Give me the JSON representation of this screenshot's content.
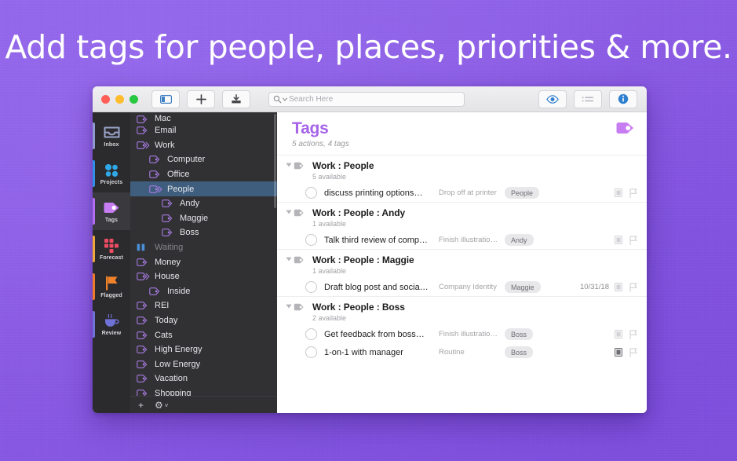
{
  "headline": "Add tags for people, places, priorities & more.",
  "theme": {
    "background_purple": "#8a5ae4",
    "tag_purple": "#a563e8",
    "title_purple": "#a563e8",
    "sidebar_dark": "#313134",
    "rail_dark": "#2b2b2e",
    "selection_blue": "#3f5e7e"
  },
  "titlebar": {
    "traffic_lights": [
      "close-button",
      "minimize-button",
      "zoom-button"
    ],
    "buttons": [
      {
        "name": "sidebar-toggle-button",
        "icon": "sidebar-icon"
      },
      {
        "name": "new-item-button",
        "icon": "plus-icon"
      },
      {
        "name": "inbox-button",
        "icon": "inbox-tray-icon"
      }
    ],
    "search": {
      "placeholder": "Search Here",
      "icon": "search-icon"
    },
    "right_buttons": [
      {
        "name": "view-options-button",
        "icon": "eye-icon"
      },
      {
        "name": "layout-button",
        "icon": "list-icon"
      },
      {
        "name": "inspector-button",
        "icon": "info-icon"
      }
    ]
  },
  "rail": {
    "items": [
      {
        "label": "Inbox",
        "icon": "inbox-icon",
        "color": "#9aa4c8",
        "stripe": "#8f9ad0",
        "selected": false
      },
      {
        "label": "Projects",
        "icon": "projects-icon",
        "color": "#2fa8e8",
        "stripe": "#2f8fe8",
        "selected": false
      },
      {
        "label": "Tags",
        "icon": "tag-icon",
        "color": "#c77cf2",
        "stripe": "#b36df0",
        "selected": true
      },
      {
        "label": "Forecast",
        "icon": "forecast-icon",
        "color": "#ef4b62",
        "stripe": "#efa93a",
        "selected": false
      },
      {
        "label": "Flagged",
        "icon": "flag-icon",
        "color": "#f0822a",
        "stripe": "#ef7b2a",
        "selected": false
      },
      {
        "label": "Review",
        "icon": "review-cup-icon",
        "color": "#6f72d6",
        "stripe": "#6f72d6",
        "selected": false
      }
    ]
  },
  "sidebar": {
    "items": [
      {
        "label": "Mac",
        "indent": 0,
        "icon": "tag-icon",
        "selected": false,
        "dim": false,
        "clipped": true
      },
      {
        "label": "Email",
        "indent": 0,
        "icon": "tag-icon",
        "selected": false,
        "dim": false
      },
      {
        "label": "Work",
        "indent": 0,
        "icon": "tag-stack-icon",
        "selected": false,
        "dim": false
      },
      {
        "label": "Computer",
        "indent": 1,
        "icon": "tag-icon",
        "selected": false,
        "dim": false
      },
      {
        "label": "Office",
        "indent": 1,
        "icon": "tag-icon",
        "selected": false,
        "dim": false
      },
      {
        "label": "People",
        "indent": 1,
        "icon": "tag-stack-icon",
        "selected": true,
        "dim": false
      },
      {
        "label": "Andy",
        "indent": 2,
        "icon": "tag-icon",
        "selected": false,
        "dim": false
      },
      {
        "label": "Maggie",
        "indent": 2,
        "icon": "tag-icon",
        "selected": false,
        "dim": false
      },
      {
        "label": "Boss",
        "indent": 2,
        "icon": "tag-icon",
        "selected": false,
        "dim": false
      },
      {
        "label": "Waiting",
        "indent": 0,
        "icon": "pause-icon",
        "selected": false,
        "dim": true
      },
      {
        "label": "Money",
        "indent": 0,
        "icon": "tag-icon",
        "selected": false,
        "dim": false
      },
      {
        "label": "House",
        "indent": 0,
        "icon": "tag-stack-icon",
        "selected": false,
        "dim": false
      },
      {
        "label": "Inside",
        "indent": 1,
        "icon": "tag-icon",
        "selected": false,
        "dim": false
      },
      {
        "label": "REI",
        "indent": 0,
        "icon": "tag-icon",
        "selected": false,
        "dim": false
      },
      {
        "label": "Today",
        "indent": 0,
        "icon": "tag-icon",
        "selected": false,
        "dim": false
      },
      {
        "label": "Cats",
        "indent": 0,
        "icon": "tag-icon",
        "selected": false,
        "dim": false
      },
      {
        "label": "High Energy",
        "indent": 0,
        "icon": "tag-icon",
        "selected": false,
        "dim": false
      },
      {
        "label": "Low Energy",
        "indent": 0,
        "icon": "tag-icon",
        "selected": false,
        "dim": false
      },
      {
        "label": "Vacation",
        "indent": 0,
        "icon": "tag-icon",
        "selected": false,
        "dim": false
      },
      {
        "label": "Shopping",
        "indent": 0,
        "icon": "tag-icon",
        "selected": false,
        "dim": false
      }
    ],
    "footer": {
      "add_label": "+",
      "gear_label": "⚙",
      "gear_chevron": "˅"
    }
  },
  "content": {
    "title": "Tags",
    "subtitle": "5 actions, 4 tags",
    "header_badge_icon": "tag-filled-icon",
    "groups": [
      {
        "title": "Work : People",
        "count": "5 available",
        "tasks": [
          {
            "title": "discuss printing options…",
            "project": "Drop off at printer",
            "tag": "People",
            "date": "",
            "note_filled": false
          }
        ]
      },
      {
        "title": "Work : People : Andy",
        "count": "1 available",
        "tasks": [
          {
            "title": "Talk third review of comp…",
            "project": "Finish illustratio…",
            "tag": "Andy",
            "date": "",
            "note_filled": false
          }
        ]
      },
      {
        "title": "Work : People : Maggie",
        "count": "1 available",
        "tasks": [
          {
            "title": "Draft blog post and socia…",
            "project": "Company Identity",
            "tag": "Maggie",
            "date": "10/31/18",
            "note_filled": false
          }
        ]
      },
      {
        "title": "Work : People : Boss",
        "count": "2 available",
        "tasks": [
          {
            "title": "Get feedback from boss…",
            "project": "Finish illustratio…",
            "tag": "Boss",
            "date": "",
            "note_filled": false
          },
          {
            "title": "1-on-1 with manager",
            "project": "Routine",
            "tag": "Boss",
            "date": "",
            "note_filled": true
          }
        ]
      }
    ]
  }
}
